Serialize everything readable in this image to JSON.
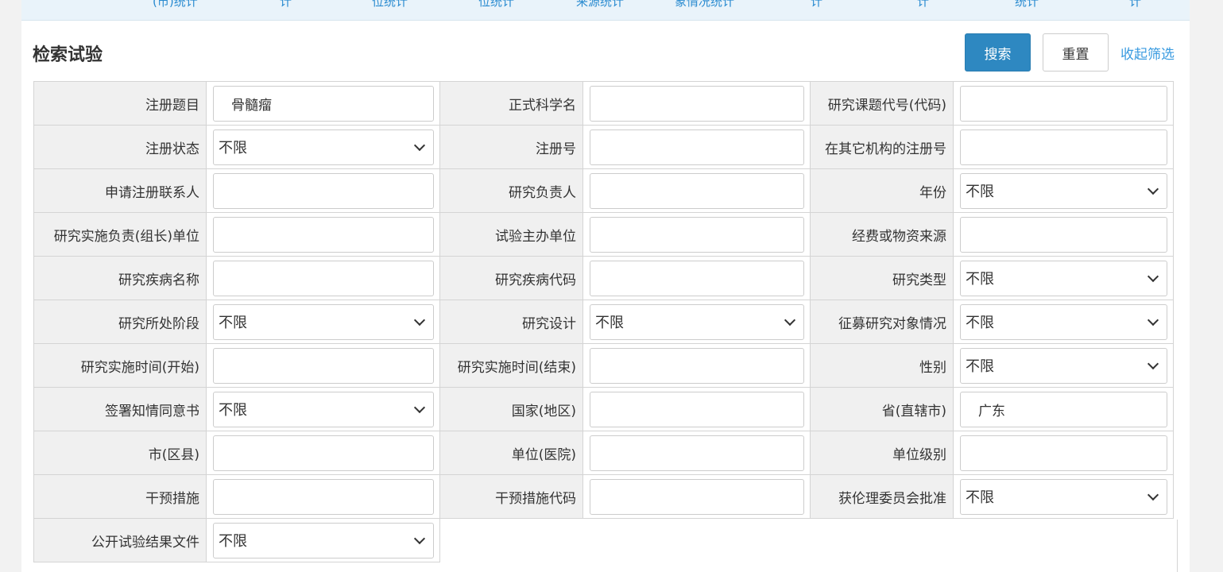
{
  "top_nav": [
    "(市)统计",
    "计",
    "位统计",
    "位统计",
    "来源统计",
    "象情况统计",
    "计",
    "计",
    "统计",
    "计"
  ],
  "header": {
    "title": "检索试验",
    "search_label": "搜索",
    "reset_label": "重置",
    "collapse_label": "收起筛选"
  },
  "rows": [
    [
      {
        "label": "注册题目",
        "type": "input",
        "value": "骨髓瘤"
      },
      {
        "label": "正式科学名",
        "type": "input",
        "value": ""
      },
      {
        "label": "研究课题代号(代码)",
        "type": "input",
        "value": ""
      }
    ],
    [
      {
        "label": "注册状态",
        "type": "select",
        "value": "不限"
      },
      {
        "label": "注册号",
        "type": "input",
        "value": ""
      },
      {
        "label": "在其它机构的注册号",
        "type": "input",
        "value": ""
      }
    ],
    [
      {
        "label": "申请注册联系人",
        "type": "input",
        "value": ""
      },
      {
        "label": "研究负责人",
        "type": "input",
        "value": ""
      },
      {
        "label": "年份",
        "type": "select",
        "value": "不限"
      }
    ],
    [
      {
        "label": "研究实施负责(组长)单位",
        "type": "input",
        "value": ""
      },
      {
        "label": "试验主办单位",
        "type": "input",
        "value": ""
      },
      {
        "label": "经费或物资来源",
        "type": "input",
        "value": ""
      }
    ],
    [
      {
        "label": "研究疾病名称",
        "type": "input",
        "value": ""
      },
      {
        "label": "研究疾病代码",
        "type": "input",
        "value": ""
      },
      {
        "label": "研究类型",
        "type": "select",
        "value": "不限"
      }
    ],
    [
      {
        "label": "研究所处阶段",
        "type": "select",
        "value": "不限"
      },
      {
        "label": "研究设计",
        "type": "select",
        "value": "不限"
      },
      {
        "label": "征募研究对象情况",
        "type": "select",
        "value": "不限"
      }
    ],
    [
      {
        "label": "研究实施时间(开始)",
        "type": "input",
        "value": ""
      },
      {
        "label": "研究实施时间(结束)",
        "type": "input",
        "value": ""
      },
      {
        "label": "性别",
        "type": "select",
        "value": "不限"
      }
    ],
    [
      {
        "label": "签署知情同意书",
        "type": "select",
        "value": "不限"
      },
      {
        "label": "国家(地区)",
        "type": "input",
        "value": ""
      },
      {
        "label": "省(直辖市)",
        "type": "input",
        "value": "广东"
      }
    ],
    [
      {
        "label": "市(区县)",
        "type": "input",
        "value": ""
      },
      {
        "label": "单位(医院)",
        "type": "input",
        "value": ""
      },
      {
        "label": "单位级别",
        "type": "input",
        "value": ""
      }
    ],
    [
      {
        "label": "干预措施",
        "type": "input",
        "value": ""
      },
      {
        "label": "干预措施代码",
        "type": "input",
        "value": ""
      },
      {
        "label": "获伦理委员会批准",
        "type": "select",
        "value": "不限"
      }
    ],
    [
      {
        "label": "公开试验结果文件",
        "type": "select",
        "value": "不限"
      }
    ]
  ]
}
